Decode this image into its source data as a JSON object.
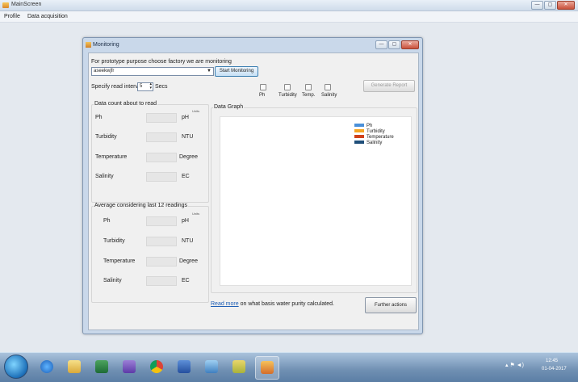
{
  "window": {
    "title": "MainScreen",
    "buttons": [
      "—",
      "▢",
      "✕"
    ]
  },
  "menu": {
    "items": [
      "Profile",
      "Data acquisition"
    ]
  },
  "monitor": {
    "title": "Monitoring",
    "buttons": [
      "—",
      "▢",
      "✕"
    ],
    "factory_prompt": "For prototype purpose choose factory we are monitoring",
    "factory_value": "aseekwjfr",
    "start_label": "Start Monitoring",
    "interval_label": "Specify read interval",
    "interval_value": "5",
    "interval_unit": "Secs",
    "checkboxes": [
      "Ph",
      "Turbidity",
      "Temp.",
      "Salinity"
    ],
    "report_label": "Generate Report",
    "count_group": {
      "title": "Data count about to read",
      "units_header": "Units",
      "rows": [
        {
          "name": "Ph",
          "unit": "pH"
        },
        {
          "name": "Turbidity",
          "unit": "NTU"
        },
        {
          "name": "Temperature",
          "unit": "Degree"
        },
        {
          "name": "Salinity",
          "unit": "EC"
        }
      ]
    },
    "avg_group": {
      "title": "Average considering last 12 readings",
      "units_header": "Units",
      "rows": [
        {
          "name": "Ph",
          "unit": "pH"
        },
        {
          "name": "Turbidity",
          "unit": "NTU"
        },
        {
          "name": "Temperature",
          "unit": "Degree"
        },
        {
          "name": "Salinity",
          "unit": "EC"
        }
      ]
    },
    "graph_title": "Data Graph",
    "legend": [
      {
        "name": "Ph",
        "color": "#4a90d9"
      },
      {
        "name": "Turbidity",
        "color": "#f5a623"
      },
      {
        "name": "Temperature",
        "color": "#d0421b"
      },
      {
        "name": "Salinity",
        "color": "#1f4e79"
      }
    ],
    "readmore_link": "Read more",
    "readmore_text": "on what basis water purity calculated.",
    "further_label": "Further actions"
  },
  "taskbar": {
    "apps": [
      "ie-icon",
      "explorer-icon",
      "excel-icon",
      "visual-studio-icon",
      "chrome-icon",
      "word-icon",
      "paint-icon",
      "tool-icon",
      "app-icon"
    ],
    "time": "12:45",
    "date": "01-04-2017"
  }
}
